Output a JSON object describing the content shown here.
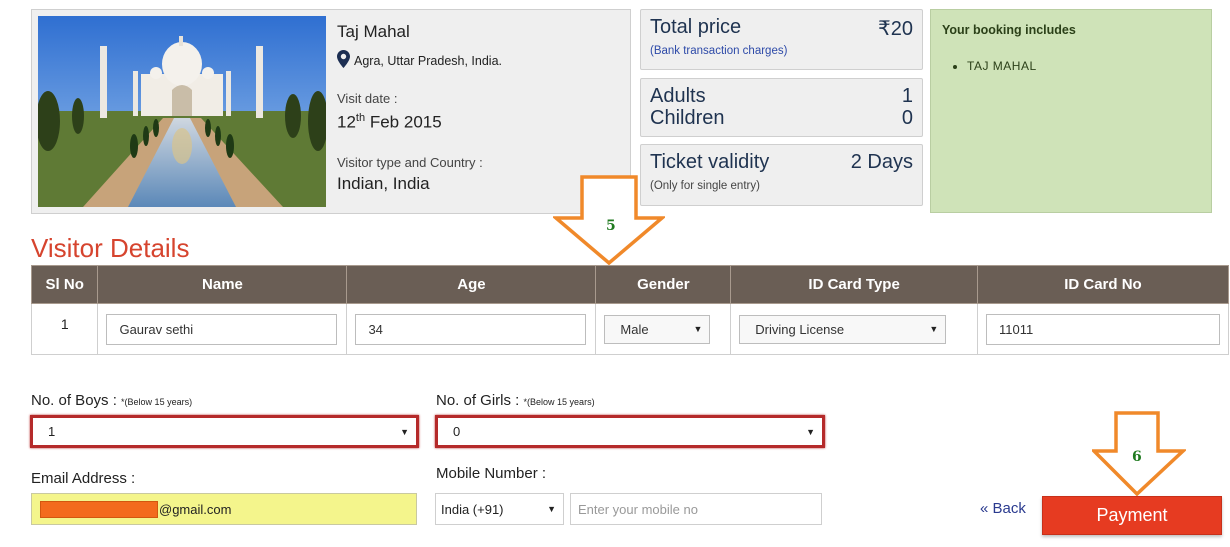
{
  "monument": {
    "name": "Taj Mahal",
    "location": "Agra, Uttar Pradesh, India.",
    "visit_date_label": "Visit date :",
    "visit_day": "12",
    "visit_day_suffix": "th",
    "visit_month_year": "Feb 2015",
    "visitor_type_label": "Visitor type and Country :",
    "visitor_type_value": "Indian, India"
  },
  "price": {
    "total_label": "Total price",
    "total_value": "₹20",
    "note": "(Bank transaction charges)",
    "adults_label": "Adults",
    "adults_value": "1",
    "children_label": "Children",
    "children_value": "0",
    "validity_label": "Ticket validity",
    "validity_value": "2 Days",
    "validity_note": "(Only for single entry)"
  },
  "includes": {
    "heading": "Your booking includes",
    "items": [
      "TAJ MAHAL"
    ]
  },
  "visitor_details": {
    "title": "Visitor Details",
    "columns": [
      "Sl No",
      "Name",
      "Age",
      "Gender",
      "ID Card Type",
      "ID Card No"
    ],
    "rows": [
      {
        "sl_no": "1",
        "name": "Gaurav sethi",
        "age": "34",
        "gender": "Male",
        "id_type": "Driving License",
        "id_no": "11011"
      }
    ]
  },
  "form": {
    "boys_label": "No. of Boys :",
    "boys_hint": "*(Below 15 years)",
    "boys_value": "1",
    "girls_label": "No. of Girls :",
    "girls_hint": "*(Below 15 years)",
    "girls_value": "0",
    "email_label": "Email Address :",
    "email_value_visible": "@gmail.com",
    "mobile_label": "Mobile Number :",
    "country_code": "India (+91)",
    "mobile_placeholder": "Enter your mobile no",
    "back_label": "« Back",
    "payment_label": "Payment"
  },
  "callouts": {
    "step_5": "5",
    "step_6": "6"
  },
  "colors": {
    "accent_red": "#e63b21",
    "heading_red": "#d6442e",
    "callout_orange": "#f0892a",
    "table_header": "#6a5e55",
    "includes_bg": "#cfe3b8"
  }
}
